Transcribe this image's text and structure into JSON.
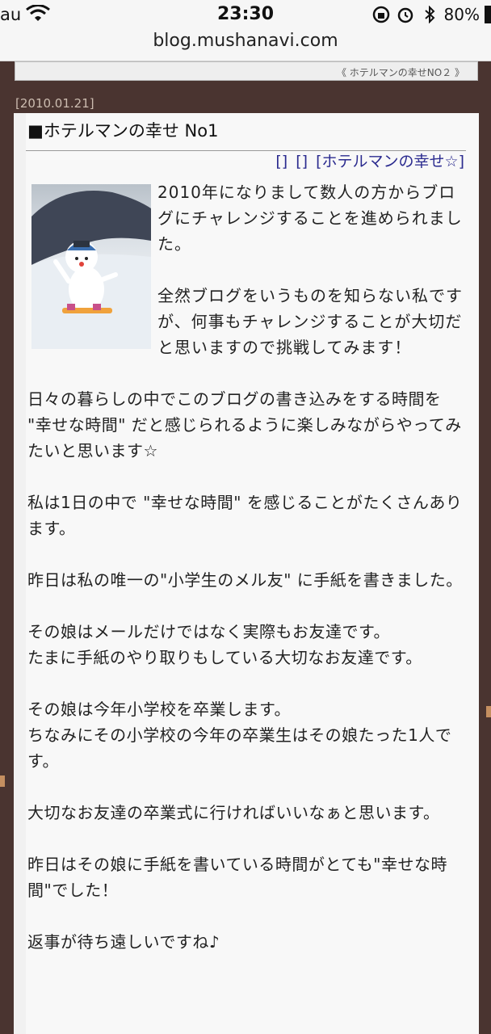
{
  "status_bar": {
    "carrier": "au",
    "time": "23:30",
    "battery": "80%"
  },
  "browser": {
    "url": "blog.mushanavi.com"
  },
  "page_nav": {
    "next_link": "《 ホテルマンの幸せNO２ 》"
  },
  "post": {
    "date": "[2010.01.21]",
    "title": "■ホテルマンの幸せ No1",
    "categories": [
      "[]",
      "[]",
      "[ホテルマンの幸せ☆]"
    ],
    "image_alt": "snowman figure on snowboard",
    "intro_paragraphs": [
      "2010年になりまして数人の方からブログにチャレンジすることを進められました。",
      "全然ブログをいうものを知らない私ですが、何事もチャレンジすることが大切だと思いますので挑戦してみます！"
    ],
    "paragraphs": [
      "日々の暮らしの中でこのブログの書き込みをする時間を \"幸せな時間\" だと感じられるように楽しみながらやってみたいと思います☆",
      "私は1日の中で \"幸せな時間\" を感じることがたくさんあります。",
      "昨日は私の唯一の\"小学生のメル友\" に手紙を書きました。",
      "その娘はメールだけではなく実際もお友達です。\nたまに手紙のやり取りもしている大切なお友達です。",
      "その娘は今年小学校を卒業します。\nちなみにその小学校の今年の卒業生はその娘たった1人です。",
      "大切なお友達の卒業式に行ければいいなぁと思います。",
      "昨日はその娘に手紙を書いている時間がとても\"幸せな時間\"でした！",
      "返事が待ち遠しいですね♪"
    ]
  }
}
